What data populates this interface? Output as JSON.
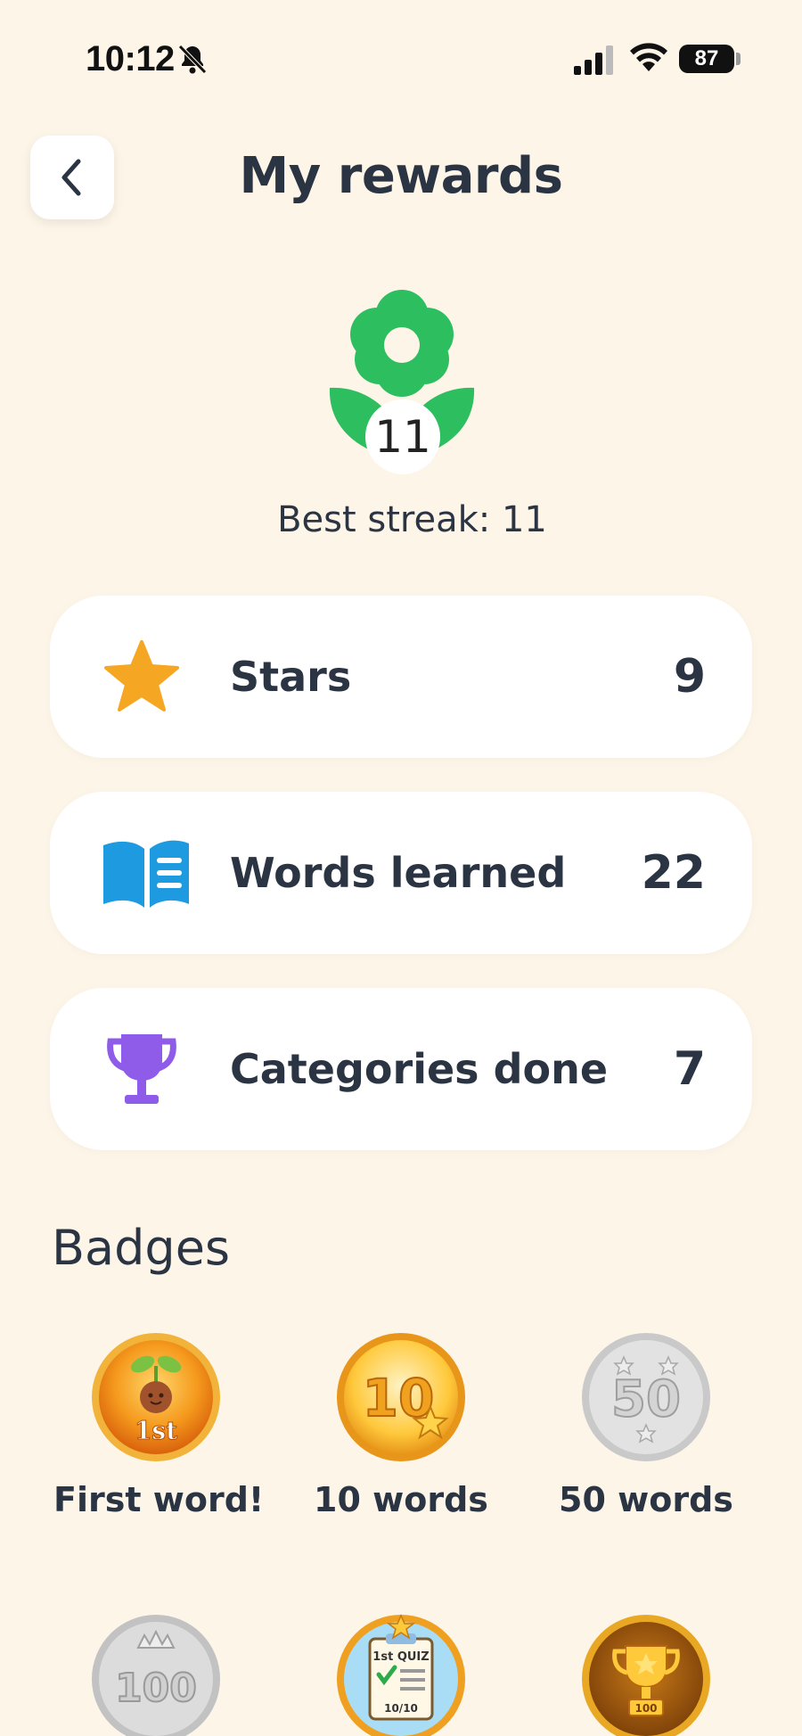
{
  "status_bar": {
    "time": "10:12",
    "battery": "87"
  },
  "header": {
    "title": "My rewards"
  },
  "streak": {
    "value": "11",
    "best_text": "Best streak: 11",
    "flower_color": "#2DBE60"
  },
  "stats": [
    {
      "label": "Stars",
      "value": "9",
      "icon": "star-icon",
      "color": "#F5A623"
    },
    {
      "label": "Words learned",
      "value": "22",
      "icon": "open-book-icon",
      "color": "#1E9BE0"
    },
    {
      "label": "Categories done",
      "value": "7",
      "icon": "trophy-icon",
      "color": "#8E5CE8"
    }
  ],
  "badges": {
    "title": "Badges",
    "items": [
      {
        "label": "First word!",
        "medal_text": "1st",
        "icon": "sprout-medal-icon",
        "earned": true
      },
      {
        "label": "10 words",
        "medal_text": "10",
        "icon": "ten-medal-icon",
        "earned": true
      },
      {
        "label": "50 words",
        "medal_text": "50",
        "icon": "fifty-medal-icon",
        "earned": false
      },
      {
        "label": "",
        "medal_text": "100",
        "icon": "hundred-medal-icon",
        "earned": false
      },
      {
        "label": "",
        "medal_text": "1st QUIZ",
        "medal_subtext": "10/10",
        "icon": "quiz-medal-icon",
        "earned": true
      },
      {
        "label": "",
        "medal_text": "100",
        "icon": "trophy-medal-icon",
        "earned": true
      }
    ]
  }
}
